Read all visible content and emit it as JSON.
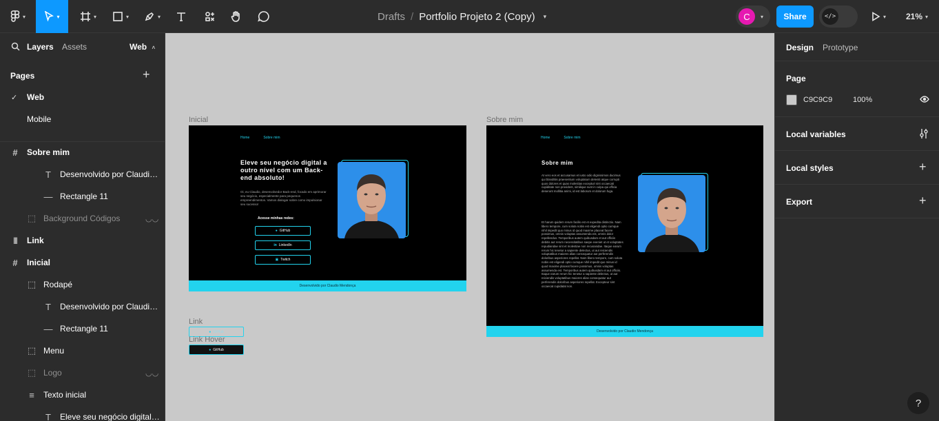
{
  "toolbar": {
    "breadcrumb_drafts": "Drafts",
    "breadcrumb_sep": "/",
    "file_name": "Portfolio Projeto 2 (Copy)",
    "avatar_initial": "C",
    "share_label": "Share",
    "devmode_glyph": "</>",
    "zoom": "21%"
  },
  "left_panel": {
    "tab_layers": "Layers",
    "tab_assets": "Assets",
    "page_switch": "Web",
    "pages_heading": "Pages",
    "pages": [
      {
        "label": "Web",
        "selected": true
      },
      {
        "label": "Mobile",
        "selected": false
      }
    ],
    "layers": [
      {
        "label": "Sobre mim",
        "icon": "frame-icon",
        "glyph": "#"
      },
      {
        "label": "Desenvolvido por Claudio...",
        "icon": "text-icon",
        "glyph": "T"
      },
      {
        "label": "Rectangle 11",
        "icon": "line-icon",
        "glyph": "—"
      },
      {
        "label": "Background Códigos",
        "icon": "group-icon",
        "glyph": "⬚"
      },
      {
        "label": "Link",
        "icon": "component-set-icon",
        "glyph": "|||"
      },
      {
        "label": "Inicial",
        "icon": "frame-icon",
        "glyph": "#"
      },
      {
        "label": "Rodapé",
        "icon": "group-icon",
        "glyph": "⬚"
      },
      {
        "label": "Desenvolvido por Claudio...",
        "icon": "text-icon",
        "glyph": "T"
      },
      {
        "label": "Rectangle 11",
        "icon": "line-icon",
        "glyph": "—"
      },
      {
        "label": "Menu",
        "icon": "group-icon",
        "glyph": "⬚"
      },
      {
        "label": "Logo",
        "icon": "group-icon",
        "glyph": "⬚"
      },
      {
        "label": "Texto inicial",
        "icon": "auto-layout-icon",
        "glyph": "≡"
      },
      {
        "label": "Eleve seu negócio digital ...",
        "icon": "text-icon",
        "glyph": "T"
      }
    ]
  },
  "canvas": {
    "background": "#C9C9C9",
    "frame_inicial": {
      "label": "Inicial",
      "nav": [
        "Home",
        "Sobre mim"
      ],
      "title": "Eleve seu negócio digital a outro nível com um Back-end absoluto!",
      "paragraph": "Oi, eu Claudio, desenvolvedor Back-end, focado em aprimorar seu negócio, especialmente para pequenos empreendimentos. Vamos dialogar sobre como impulsionar seu sucesso!",
      "social_heading": "Acesse minhas redes:",
      "social": [
        "GitHub",
        "LinkedIn",
        "Twitch"
      ],
      "footer": "Desenvolvido por Claudio Mendonça"
    },
    "frame_sobre": {
      "label": "Sobre mim",
      "nav": [
        "Home",
        "Sobre mim"
      ],
      "title": "Sobre mim",
      "p1": "At vero eos et accusamus et iusto odio dignissimos ducimus qui blanditiis praesentium voluptatum deleniti atque corrupti quos dolores et quas molestias excepturi sint occaecati cupiditate non provident, similique sunt in culpa qui officia deserunt mollitia animi, id est laborum et dolorum fuga.",
      "p2": "Et harum quidem rerum facilis est et expedita distinctio. Nam libero tempore, cum soluta nobis est eligendi optio cumque nihil impedit quo minus id quod maxime placeat facere possimus, omnis voluptas assumenda est, omnis dolor repellendus. Temporibus autem quibusdam et aut officiis debitis aut rerum necessitatibus saepe eveniet ut et voluptates repudiandae sint et molestiae non recusandae. Itaque earum rerum hic tenetur a sapiente delectus, ut aut reiciendis voluptatibus maiores alias consequatur aut perferendis doloribus asperiores repellat. Nam libero tempore, cum soluta nobis est eligendi optio cumque nihil impedit quo minus id quod maxime placeat facere possimus, omnis voluptas assumenda est. Temporibus autem quibusdam et aut officiis. Itaque earum rerum hic tenetur a sapiente delectus, ut aut reiciendis voluptatibus maiores alias consequatur aut perferendis doloribus asperiores repellat. Excepteur sint occaecat cupidatat non.",
      "footer": "Desenvolvido por Claudio Mendonça"
    },
    "component_link": {
      "label": "Link",
      "text": "GitHub"
    },
    "component_link_hover": {
      "label": "Link Hover",
      "text": "GitHub"
    }
  },
  "right_panel": {
    "tab_design": "Design",
    "tab_prototype": "Prototype",
    "page_heading": "Page",
    "page_color": "C9C9C9",
    "page_opacity": "100%",
    "local_variables": "Local variables",
    "local_styles": "Local styles",
    "export": "Export"
  },
  "help": "?"
}
